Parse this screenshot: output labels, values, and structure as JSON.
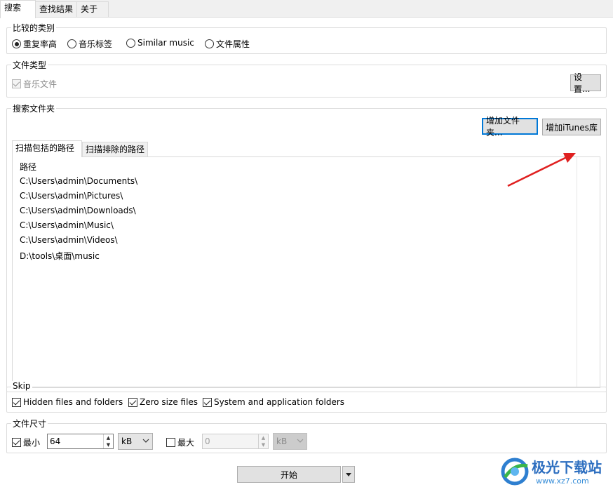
{
  "tabs": [
    {
      "label": "搜索"
    },
    {
      "label": "查找结果"
    },
    {
      "label": "关于"
    }
  ],
  "compare": {
    "title": "比较的类别",
    "options": [
      {
        "label": "重复率高",
        "selected": true
      },
      {
        "label": "音乐标签",
        "selected": false
      },
      {
        "label": "Similar music",
        "selected": false
      },
      {
        "label": "文件属性",
        "selected": false
      }
    ]
  },
  "filetype": {
    "title": "文件类型",
    "music_label": "音乐文件",
    "music_checked": true,
    "settings_button": "设置..."
  },
  "search_folders": {
    "title": "搜索文件夹",
    "add_folder_button": "增加文件夹...",
    "add_itunes_button": "增加iTunes库",
    "subtabs": [
      {
        "label": "扫描包括的路径"
      },
      {
        "label": "扫描排除的路径"
      }
    ],
    "column_header": "路径",
    "paths": [
      "C:\\Users\\admin\\Documents\\",
      "C:\\Users\\admin\\Pictures\\",
      "C:\\Users\\admin\\Downloads\\",
      "C:\\Users\\admin\\Music\\",
      "C:\\Users\\admin\\Videos\\",
      "D:\\tools\\桌面\\music"
    ]
  },
  "skip": {
    "title": "Skip",
    "items": [
      {
        "label": "Hidden files and folders",
        "checked": true
      },
      {
        "label": "Zero size files",
        "checked": true
      },
      {
        "label": "System and application folders",
        "checked": true
      }
    ]
  },
  "filesize": {
    "title": "文件尺寸",
    "min_label": "最小",
    "min_checked": true,
    "min_value": "64",
    "min_unit": "kB",
    "max_label": "最大",
    "max_checked": false,
    "max_value": "0",
    "max_unit": "kB"
  },
  "start_button": "开始",
  "watermark": {
    "text": "极光下载站",
    "url": "www.xz7.com"
  },
  "colors": {
    "accent": "#0078d7",
    "arrow": "#e02020"
  }
}
